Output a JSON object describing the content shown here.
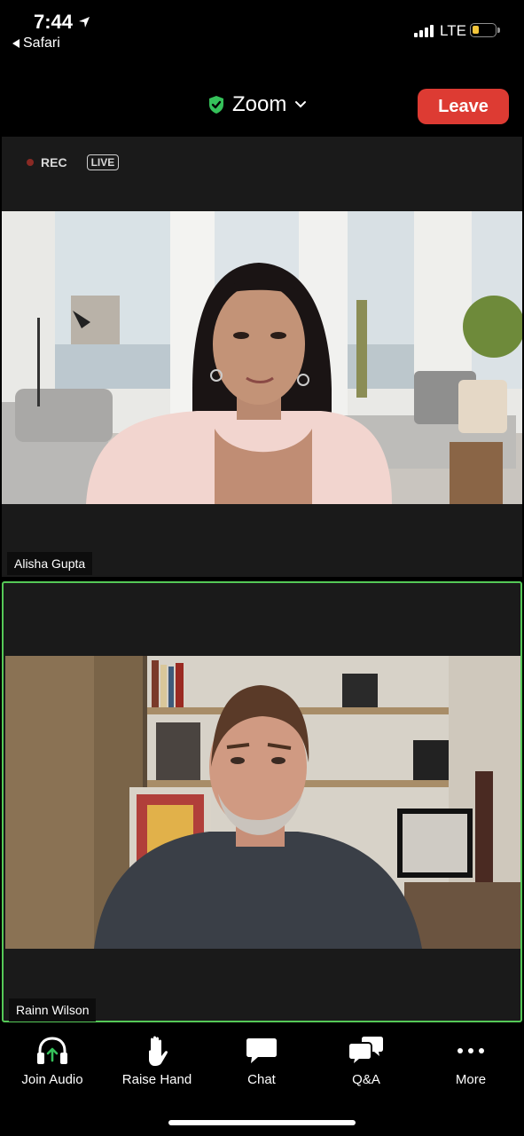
{
  "status_bar": {
    "time": "7:44",
    "back_app": "Safari",
    "network": "LTE"
  },
  "header": {
    "title": "Zoom",
    "leave_label": "Leave",
    "shield_color": "#35c15a",
    "leave_color": "#dd3b33"
  },
  "tiles": [
    {
      "rec_label": "REC",
      "live_label": "LIVE",
      "participant": "Alisha Gupta"
    },
    {
      "participant": "Rainn Wilson",
      "active_speaker_color": "#55c957"
    }
  ],
  "toolbar": {
    "items": [
      {
        "label": "Join Audio",
        "icon": "headphones-icon"
      },
      {
        "label": "Raise Hand",
        "icon": "hand-icon"
      },
      {
        "label": "Chat",
        "icon": "chat-bubble-icon"
      },
      {
        "label": "Q&A",
        "icon": "qa-bubbles-icon"
      },
      {
        "label": "More",
        "icon": "more-dots-icon"
      }
    ]
  }
}
